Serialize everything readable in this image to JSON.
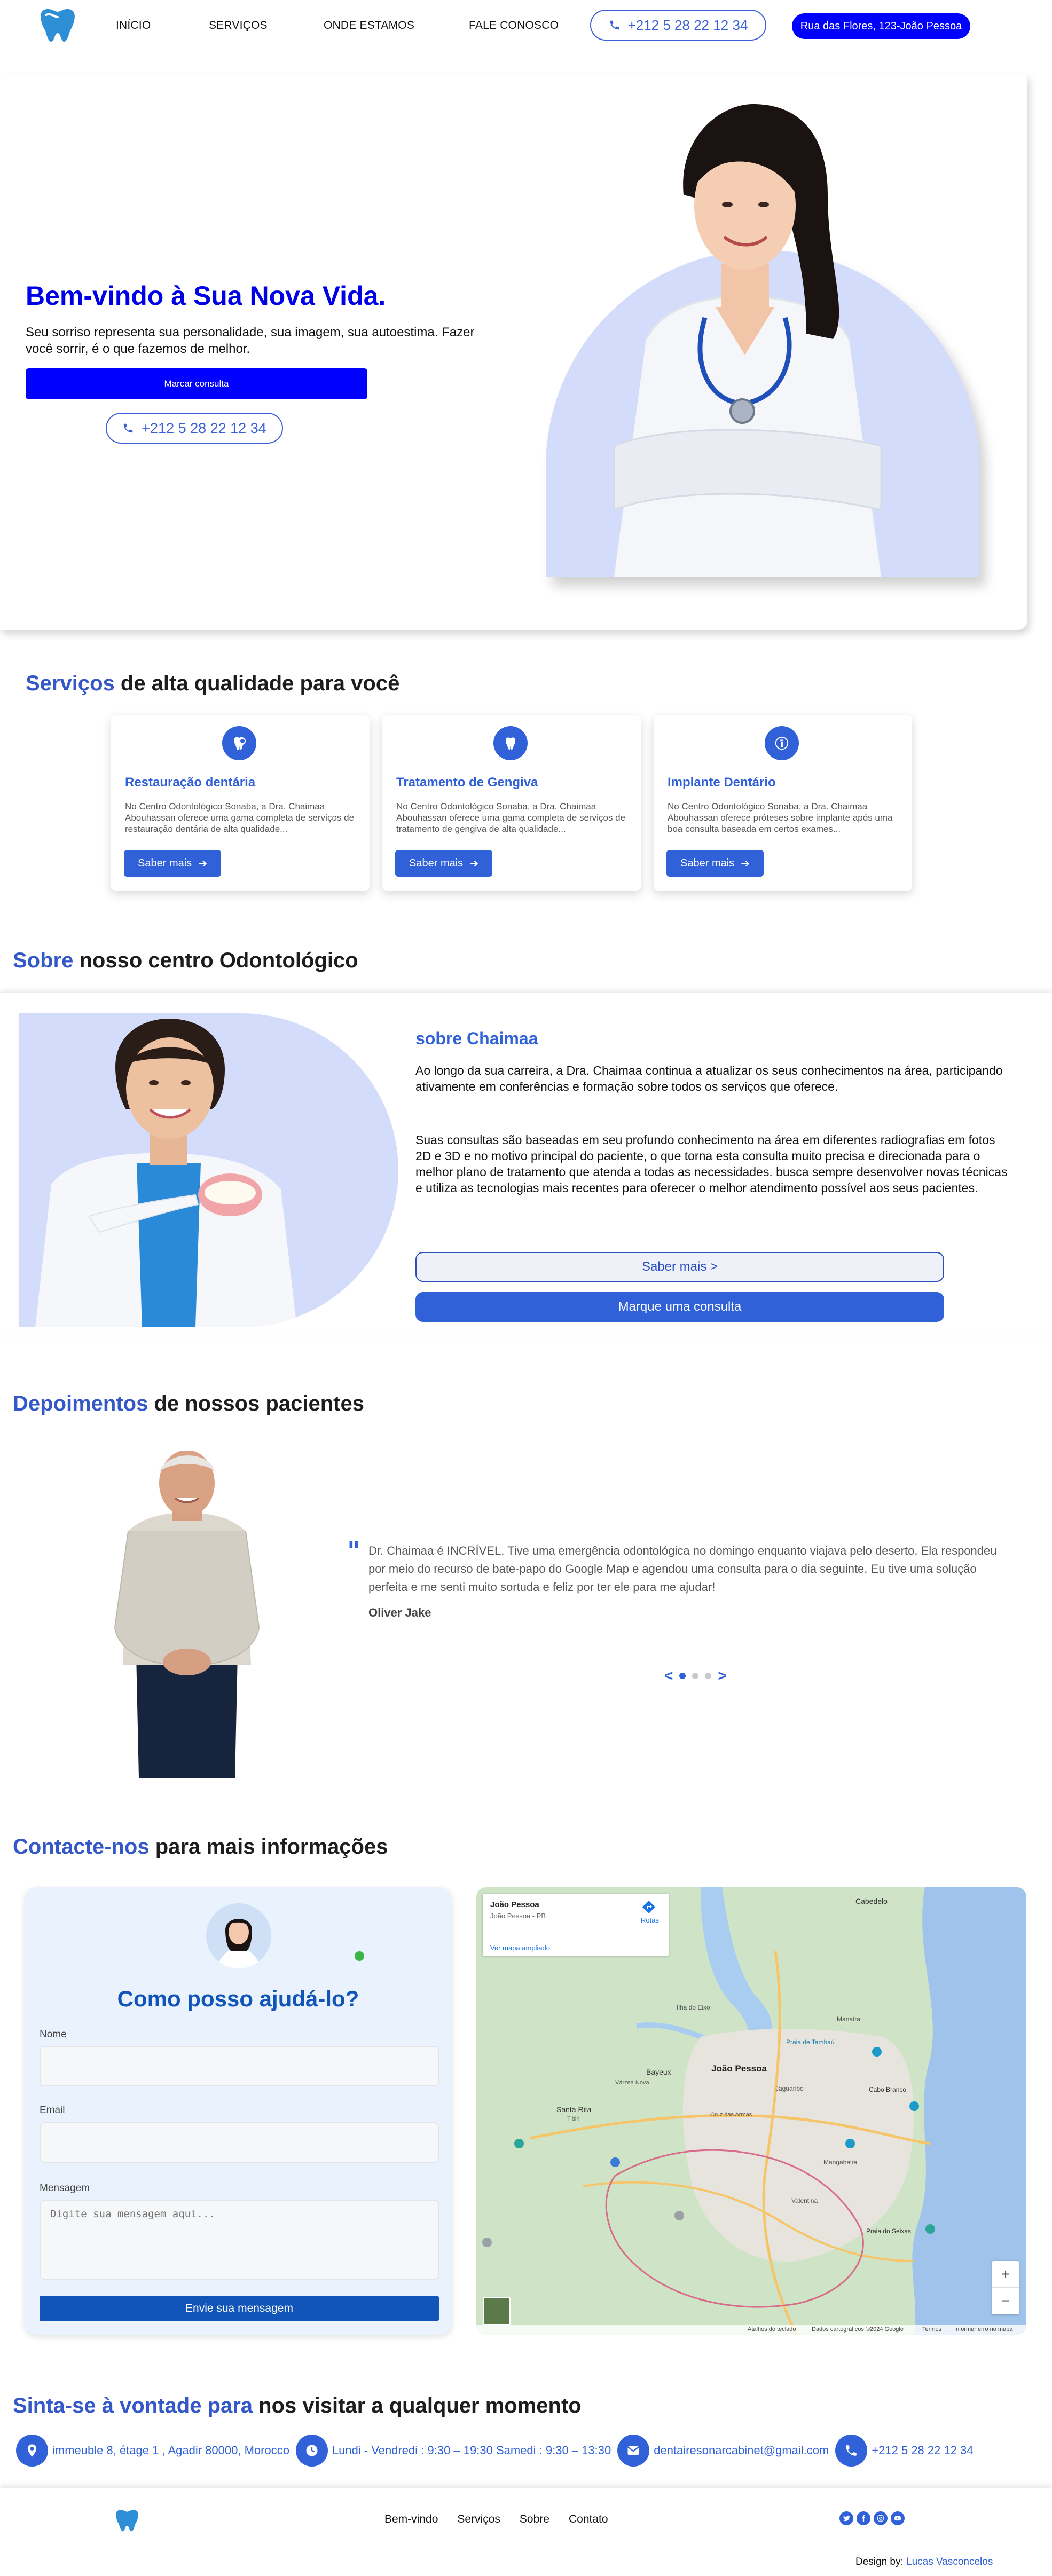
{
  "nav": {
    "links": [
      "INÍCIO",
      "SERVIÇOS",
      "ONDE ESTAMOS",
      "FALE CONOSCO"
    ],
    "phone": "+212 5 28 22 12 34",
    "address": "Rua das Flores, 123-João Pessoa"
  },
  "hero": {
    "title": "Bem-vindo à Sua Nova Vida.",
    "subtitle": "Seu sorriso representa sua personalidade, sua imagem, sua autoestima. Fazer você sorrir, é o que fazemos de melhor.",
    "cta": "Marcar consulta",
    "phone": "+212 5 28 22 12 34"
  },
  "services": {
    "heading_accent": "Serviços",
    "heading_rest": " de alta qualidade para você",
    "cards": [
      {
        "icon": "tooth-shield-icon",
        "title": "Restauração dentária",
        "text": "No Centro Odontológico Sonaba, a Dra. Chaimaa Abouhassan oferece uma gama completa de serviços de restauração dentária de alta qualidade...",
        "button": "Saber mais"
      },
      {
        "icon": "tooth-icon",
        "title": "Tratamento de Gengiva",
        "text": "No Centro Odontológico Sonaba, a Dra. Chaimaa Abouhassan oferece uma gama completa de serviços de tratamento de gengiva de alta qualidade...",
        "button": "Saber mais"
      },
      {
        "icon": "implant-icon",
        "title": "Implante Dentário",
        "text": "No Centro Odontológico Sonaba, a Dra. Chaimaa Abouhassan oferece próteses sobre implante após uma boa consulta baseada em certos exames...",
        "button": "Saber mais"
      }
    ]
  },
  "about": {
    "heading_accent": "Sobre",
    "heading_rest": " nosso centro Odontológico",
    "name": "sobre Chaimaa",
    "p1": "Ao longo da sua carreira, a Dra. Chaimaa continua a atualizar os seus conhecimentos na área, participando ativamente em conferências e formação sobre todos os serviços que oferece.",
    "p2": "Suas consultas são baseadas em seu profundo conhecimento na área em diferentes radiografias em fotos 2D e 3D e no motivo principal do paciente, o que torna esta consulta muito precisa e direcionada para o melhor plano de tratamento que atenda a todas as necessidades. busca sempre desenvolver novas técnicas e utiliza as tecnologias mais recentes para oferecer o melhor atendimento possível aos seus pacientes.",
    "more_btn": "Saber mais >",
    "book_btn": "Marque uma consulta"
  },
  "testimonials": {
    "heading_accent": "Depoimentos",
    "heading_rest": " de nossos pacientes",
    "quote_mark": "\"",
    "text": "Dr. Chaimaa é INCRÍVEL. Tive uma emergência odontológica no domingo enquanto viajava pelo deserto. Ela respondeu por meio do recurso de bate-papo do Google Map e agendou uma consulta para o dia seguinte. Eu tive uma solução perfeita e me senti muito sortuda e feliz por ter ele para me ajudar!",
    "author": "Oliver Jake",
    "prev": "<",
    "next": ">"
  },
  "contact": {
    "heading_accent": "Contacte-nos",
    "heading_rest": " para mais informações",
    "form_title": "Como posso ajudá-lo?",
    "name_label": "Nome",
    "email_label": "Email",
    "message_label": "Mensagem",
    "message_placeholder": "Digite sua mensagem aqui...",
    "submit": "Envie sua mensagem",
    "map": {
      "city": "João Pessoa",
      "region": "João Pessoa - PB",
      "route": "Rotas",
      "view_larger": "Ver mapa ampliado",
      "labels": [
        "João Pessoa",
        "Cabedelo",
        "Bayeux",
        "Santa Rita",
        "Várzea Nova",
        "Jaguaribe",
        "Mangabeira",
        "Ilha do Eixo",
        "Manaíra",
        "Cruz das Armas",
        "Valentina",
        "Praia do Seixas",
        "Praia de Tambaú",
        "Cabo Branco",
        "Tibiri"
      ],
      "attribution": [
        "Atalhos do teclado",
        "Dados cartográficos ©2024 Google",
        "Termos",
        "Informar erro no mapa"
      ]
    }
  },
  "visit": {
    "heading_accent": "Sinta-se à vontade para",
    "heading_rest": " nos visitar a qualquer momento",
    "address": "immeuble 8, étage 1 , Agadir 80000, Morocco",
    "hours": "Lundi - Vendredi : 9:30 – 19:30 Samedi : 9:30 – 13:30",
    "email": "dentairesonarcabinet@gmail.com",
    "phone": "+212 5 28 22 12 34"
  },
  "footer": {
    "links": [
      "Bem-vindo",
      "Serviços",
      "Sobre",
      "Contato"
    ],
    "design_label": "Design by: ",
    "design_author": "Lucas Vasconcelos"
  },
  "colors": {
    "primary_blue": "#0000ff",
    "accent_blue": "#3161d8",
    "arch_bg": "#d3dcfb"
  }
}
